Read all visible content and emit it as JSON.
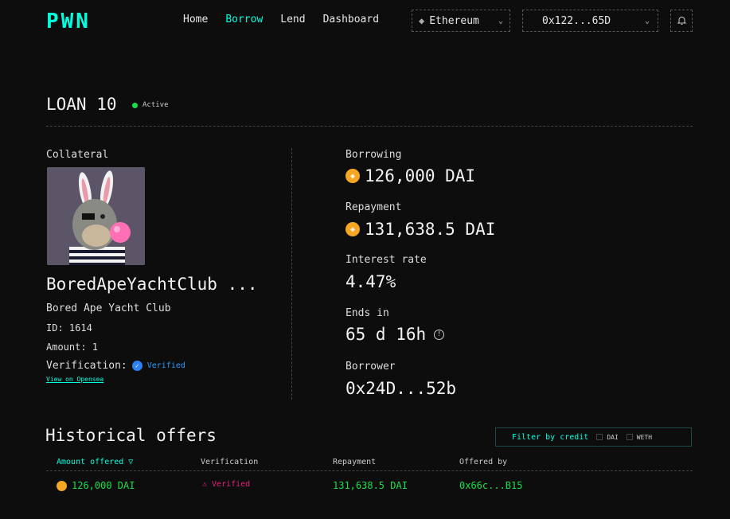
{
  "header": {
    "logo": "PWN",
    "nav": [
      "Home",
      "Borrow",
      "Lend",
      "Dashboard"
    ],
    "active_nav": "Borrow",
    "network": "Ethereum",
    "wallet": "0x122...65D"
  },
  "loan": {
    "title": "LOAN 10",
    "status": "Active"
  },
  "collateral": {
    "label": "Collateral",
    "name": "BoredApeYachtClub ...",
    "collection": "Bored Ape Yacht Club",
    "id": "ID: 1614",
    "amount": "Amount: 1",
    "verification_label": "Verification:",
    "verification_status": "Verified",
    "opensea_link": "View on Opensea"
  },
  "stats": {
    "borrowing_label": "Borrowing",
    "borrowing_value": "126,000 DAI",
    "repayment_label": "Repayment",
    "repayment_value": "131,638.5 DAI",
    "interest_label": "Interest rate",
    "interest_value": "4.47%",
    "ends_label": "Ends in",
    "ends_value": "65 d 16h",
    "borrower_label": "Borrower",
    "borrower_value": "0x24D...52b"
  },
  "offers": {
    "title": "Historical offers",
    "filter_label": "Filter by credit",
    "filter_options": [
      "DAI",
      "WETH"
    ],
    "columns": [
      "Amount offered ▽",
      "Verification",
      "Repayment",
      "Offered by"
    ],
    "rows": [
      {
        "amount": "126,000 DAI",
        "verification": "Verified",
        "repayment": "131,638.5 DAI",
        "offered_by": "0x66c...B15"
      }
    ]
  },
  "colors": {
    "accent": "#00ffe0",
    "status_green": "#19e04a",
    "verified_blue": "#2d9cff",
    "pink": "#e6227a",
    "coin": "#f5a623"
  }
}
